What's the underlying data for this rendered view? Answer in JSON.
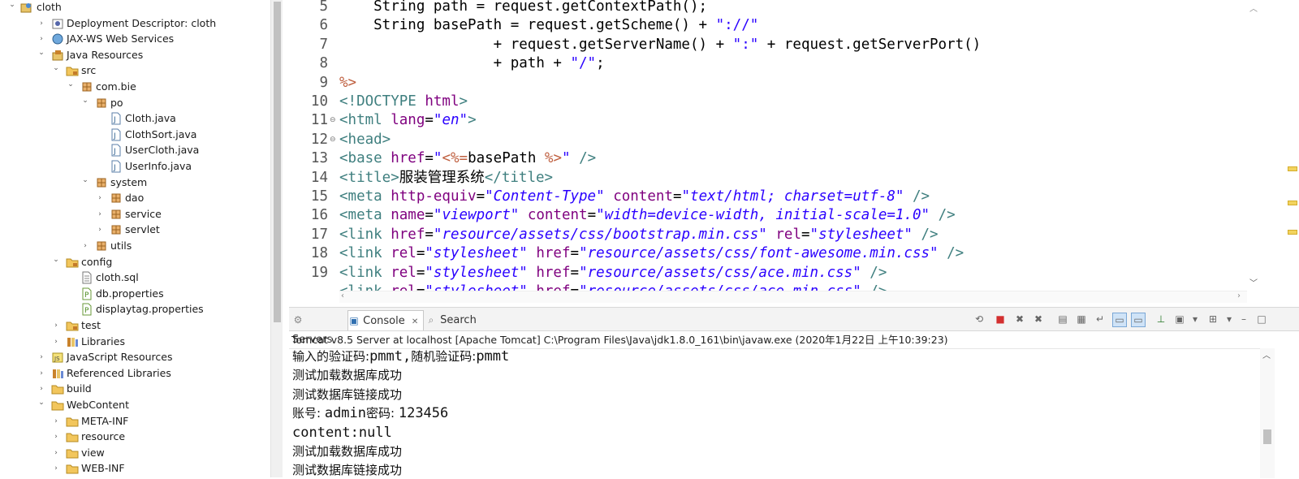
{
  "explorer": {
    "items": [
      {
        "label": "cloth",
        "icon": "project-icon",
        "expanded": true
      },
      {
        "label": "Deployment Descriptor: cloth",
        "icon": "deployment-descriptor-icon",
        "expanded": false
      },
      {
        "label": "JAX-WS Web Services",
        "icon": "web-services-icon",
        "expanded": false
      },
      {
        "label": "Java Resources",
        "icon": "java-resources-icon",
        "expanded": true
      },
      {
        "label": "src",
        "icon": "source-folder-icon",
        "expanded": true
      },
      {
        "label": "com.bie",
        "icon": "package-icon",
        "expanded": true
      },
      {
        "label": "po",
        "icon": "package-icon",
        "expanded": true
      },
      {
        "label": "Cloth.java",
        "icon": "java-file-icon",
        "expanded": false
      },
      {
        "label": "ClothSort.java",
        "icon": "java-file-icon",
        "expanded": false
      },
      {
        "label": "UserCloth.java",
        "icon": "java-file-icon",
        "expanded": false
      },
      {
        "label": "UserInfo.java",
        "icon": "java-file-icon",
        "expanded": false
      },
      {
        "label": "system",
        "icon": "package-icon",
        "expanded": true
      },
      {
        "label": "dao",
        "icon": "package-icon",
        "expanded": false
      },
      {
        "label": "service",
        "icon": "package-icon",
        "expanded": false
      },
      {
        "label": "servlet",
        "icon": "package-icon",
        "expanded": false
      },
      {
        "label": "utils",
        "icon": "package-icon",
        "expanded": false
      },
      {
        "label": "config",
        "icon": "source-folder-icon",
        "expanded": true
      },
      {
        "label": "cloth.sql",
        "icon": "sql-file-icon",
        "expanded": false
      },
      {
        "label": "db.properties",
        "icon": "properties-file-icon",
        "expanded": false
      },
      {
        "label": "displaytag.properties",
        "icon": "properties-file-icon",
        "expanded": false
      },
      {
        "label": "test",
        "icon": "source-folder-icon",
        "expanded": false
      },
      {
        "label": "Libraries",
        "icon": "libraries-icon",
        "expanded": false
      },
      {
        "label": "JavaScript Resources",
        "icon": "javascript-resources-icon",
        "expanded": false
      },
      {
        "label": "Referenced Libraries",
        "icon": "libraries-icon",
        "expanded": false
      },
      {
        "label": "build",
        "icon": "folder-icon",
        "expanded": false
      },
      {
        "label": "WebContent",
        "icon": "folder-icon",
        "expanded": true
      },
      {
        "label": "META-INF",
        "icon": "folder-icon",
        "expanded": false
      },
      {
        "label": "resource",
        "icon": "folder-icon",
        "expanded": false
      },
      {
        "label": "view",
        "icon": "folder-icon",
        "expanded": false
      },
      {
        "label": "WEB-INF",
        "icon": "folder-icon",
        "expanded": false
      }
    ]
  },
  "editor": {
    "lines": [
      {
        "n": "5",
        "segs": [
          {
            "t": "    String path = request.getContextPath();",
            "c": "kw"
          }
        ]
      },
      {
        "n": "6",
        "segs": [
          {
            "t": "    String basePath = request.getScheme() + ",
            "c": "kw"
          },
          {
            "t": "\"://\"",
            "c": "str"
          }
        ]
      },
      {
        "n": "7",
        "segs": [
          {
            "t": "                  + request.getServerName() + ",
            "c": "kw"
          },
          {
            "t": "\":\"",
            "c": "str"
          },
          {
            "t": " + request.getServerPort()",
            "c": "kw"
          }
        ]
      },
      {
        "n": "8",
        "segs": [
          {
            "t": "                  + path + ",
            "c": "kw"
          },
          {
            "t": "\"/\"",
            "c": "str"
          },
          {
            "t": ";",
            "c": "kw"
          }
        ]
      },
      {
        "n": "9",
        "segs": [
          {
            "t": "%>",
            "c": "jsp"
          }
        ]
      },
      {
        "n": "10",
        "segs": [
          {
            "t": "<!DOCTYPE ",
            "c": "tag"
          },
          {
            "t": "html",
            "c": "attr"
          },
          {
            "t": ">",
            "c": "tag"
          }
        ]
      },
      {
        "n": "11",
        "fold": "⊖",
        "segs": [
          {
            "t": "<html ",
            "c": "tag"
          },
          {
            "t": "lang",
            "c": "attr"
          },
          {
            "t": "=",
            "c": "kw"
          },
          {
            "t": "\"en\"",
            "c": "val"
          },
          {
            "t": ">",
            "c": "tag"
          }
        ]
      },
      {
        "n": "12",
        "fold": "⊖",
        "segs": [
          {
            "t": "<head>",
            "c": "tag"
          }
        ]
      },
      {
        "n": "13",
        "segs": [
          {
            "t": "<base ",
            "c": "tag"
          },
          {
            "t": "href",
            "c": "attr"
          },
          {
            "t": "=",
            "c": "kw"
          },
          {
            "t": "\"",
            "c": "val"
          },
          {
            "t": "<%=",
            "c": "jsp"
          },
          {
            "t": "basePath ",
            "c": "kw"
          },
          {
            "t": "%>",
            "c": "jsp"
          },
          {
            "t": "\"",
            "c": "val"
          },
          {
            "t": " />",
            "c": "tag"
          }
        ]
      },
      {
        "n": "14",
        "segs": [
          {
            "t": "<title>",
            "c": "tag"
          },
          {
            "t": "服装管理系统",
            "c": "kw"
          },
          {
            "t": "</title>",
            "c": "tag"
          }
        ]
      },
      {
        "n": "15",
        "segs": [
          {
            "t": "<meta ",
            "c": "tag"
          },
          {
            "t": "http-equiv",
            "c": "attr"
          },
          {
            "t": "=",
            "c": "kw"
          },
          {
            "t": "\"Content-Type\"",
            "c": "val"
          },
          {
            "t": " ",
            "c": "kw"
          },
          {
            "t": "content",
            "c": "attr"
          },
          {
            "t": "=",
            "c": "kw"
          },
          {
            "t": "\"text/html; charset=utf-8\"",
            "c": "val"
          },
          {
            "t": " />",
            "c": "tag"
          }
        ]
      },
      {
        "n": "16",
        "segs": [
          {
            "t": "<meta ",
            "c": "tag"
          },
          {
            "t": "name",
            "c": "attr"
          },
          {
            "t": "=",
            "c": "kw"
          },
          {
            "t": "\"viewport\"",
            "c": "val"
          },
          {
            "t": " ",
            "c": "kw"
          },
          {
            "t": "content",
            "c": "attr"
          },
          {
            "t": "=",
            "c": "kw"
          },
          {
            "t": "\"width=device-width, initial-scale=1.0\"",
            "c": "val"
          },
          {
            "t": " />",
            "c": "tag"
          }
        ]
      },
      {
        "n": "17",
        "segs": [
          {
            "t": "<link ",
            "c": "tag"
          },
          {
            "t": "href",
            "c": "attr"
          },
          {
            "t": "=",
            "c": "kw"
          },
          {
            "t": "\"resource/assets/css/bootstrap.min.css\"",
            "c": "val"
          },
          {
            "t": " ",
            "c": "kw"
          },
          {
            "t": "rel",
            "c": "attr"
          },
          {
            "t": "=",
            "c": "kw"
          },
          {
            "t": "\"stylesheet\"",
            "c": "val"
          },
          {
            "t": " />",
            "c": "tag"
          }
        ]
      },
      {
        "n": "18",
        "segs": [
          {
            "t": "<link ",
            "c": "tag"
          },
          {
            "t": "rel",
            "c": "attr"
          },
          {
            "t": "=",
            "c": "kw"
          },
          {
            "t": "\"stylesheet\"",
            "c": "val"
          },
          {
            "t": " ",
            "c": "kw"
          },
          {
            "t": "href",
            "c": "attr"
          },
          {
            "t": "=",
            "c": "kw"
          },
          {
            "t": "\"resource/assets/css/font-awesome.min.css\"",
            "c": "val"
          },
          {
            "t": " />",
            "c": "tag"
          }
        ]
      },
      {
        "n": "19",
        "segs": [
          {
            "t": "<link ",
            "c": "tag"
          },
          {
            "t": "rel",
            "c": "attr"
          },
          {
            "t": "=",
            "c": "kw"
          },
          {
            "t": "\"stylesheet\"",
            "c": "val"
          },
          {
            "t": " ",
            "c": "kw"
          },
          {
            "t": "href",
            "c": "attr"
          },
          {
            "t": "=",
            "c": "kw"
          },
          {
            "t": "\"resource/assets/css/ace.min.css\"",
            "c": "val"
          },
          {
            "t": " />",
            "c": "tag"
          }
        ]
      }
    ]
  },
  "console": {
    "tabs": [
      {
        "label": "Servers",
        "icon": "servers-icon",
        "active": false
      },
      {
        "label": "Console",
        "icon": "console-icon",
        "active": true
      },
      {
        "label": "Search",
        "icon": "search-icon",
        "active": false
      }
    ],
    "close_glyph": "✕",
    "description": "Tomcat v8.5 Server at localhost [Apache Tomcat] C:\\Program Files\\Java\\jdk1.8.0_161\\bin\\javaw.exe (2020年1月22日 上午10:39:23)",
    "lines": [
      [
        {
          "t": "输入的验证码:",
          "m": false
        },
        {
          "t": "pmmt,",
          "m": true
        },
        {
          "t": "随机验证码:",
          "m": false
        },
        {
          "t": "pmmt",
          "m": true
        }
      ],
      [
        {
          "t": "测试加载数据库成功",
          "m": false
        }
      ],
      [
        {
          "t": "测试数据库链接成功",
          "m": false
        }
      ],
      [
        {
          "t": "账号: ",
          "m": false
        },
        {
          "t": "admin",
          "m": true
        },
        {
          "t": "密码: ",
          "m": false
        },
        {
          "t": "123456",
          "m": true
        }
      ],
      [
        {
          "t": "content:null",
          "m": true
        }
      ],
      [
        {
          "t": "测试加载数据库成功",
          "m": false
        }
      ],
      [
        {
          "t": "测试数据库链接成功",
          "m": false
        }
      ]
    ],
    "toolbar": [
      "terminate-icon",
      "remove-launch-icon",
      "remove-all-terminated-icon",
      "clear-console-icon",
      "scroll-lock-icon",
      "word-wrap-icon",
      "show-on-stdout-icon",
      "show-on-stderr-icon",
      "pin-console-icon",
      "display-selected-console-icon",
      "dropdown-icon",
      "open-console-icon",
      "dropdown-icon",
      "minimize-icon",
      "maximize-icon"
    ]
  },
  "colors": {
    "string": "#2a00ff",
    "tag": "#3f7f7f",
    "attribute": "#7f007f",
    "jsp": "#bf5f3f",
    "active_tab": "#2f6fb0"
  }
}
